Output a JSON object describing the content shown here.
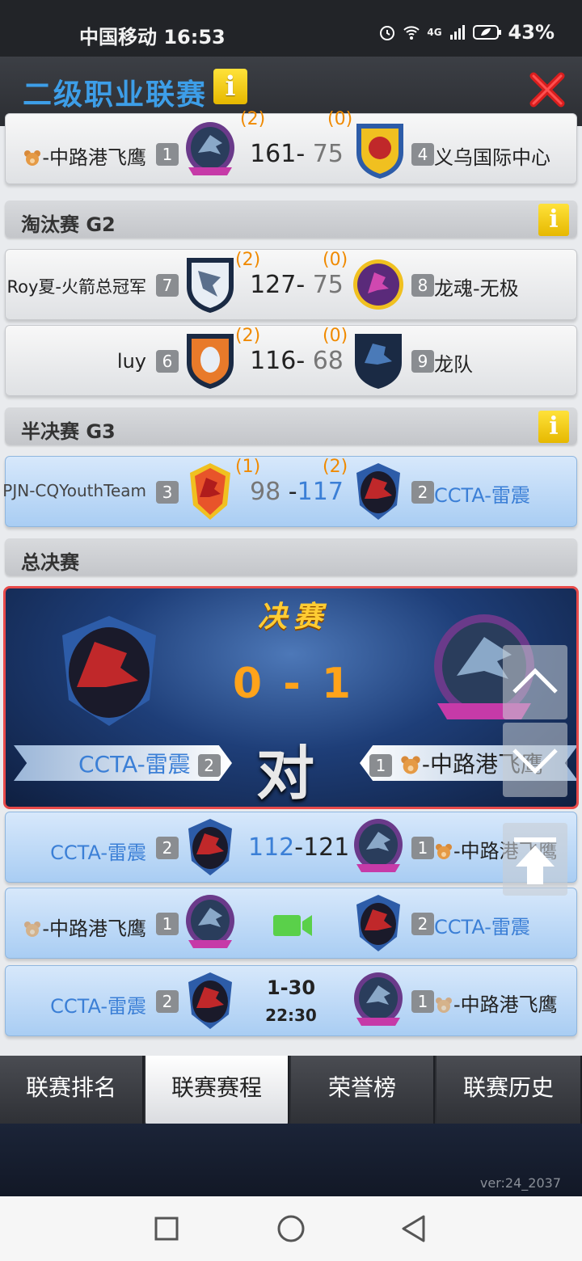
{
  "status_bar": {
    "carrier_time": "中国移动 16:53",
    "battery": "43%",
    "network": "4G"
  },
  "header": {
    "title": "二级职业联赛",
    "info_label": "i"
  },
  "matches_top": {
    "team_left": "-中路港飞鹰",
    "seed_left": "1",
    "wins_left": "(2)",
    "score_left": "161",
    "score_right": "75",
    "wins_right": "(0)",
    "seed_right": "4",
    "team_right": "义乌国际中心"
  },
  "sections": {
    "g2": "淘汰赛 G2",
    "g3": "半决赛 G3",
    "final": "总决赛"
  },
  "g2_matches": [
    {
      "team_left": "Roy夏-火箭总冠军",
      "seed_left": "7",
      "wins_left": "(2)",
      "score_left": "127",
      "score_right": "75",
      "wins_right": "(0)",
      "seed_right": "8",
      "team_right": "龙魂-无极"
    },
    {
      "team_left": "luy",
      "seed_left": "6",
      "wins_left": "(2)",
      "score_left": "116",
      "score_right": "68",
      "wins_right": "(0)",
      "seed_right": "9",
      "team_right": "龙队"
    }
  ],
  "g3_match": {
    "team_left": "PJN-CQYouthTeam",
    "seed_left": "3",
    "wins_left": "(1)",
    "score_left": "98",
    "score_right": "117",
    "wins_right": "(2)",
    "seed_right": "2",
    "team_right": "CCTA-雷震"
  },
  "final": {
    "title": "决赛",
    "series_score": "0 - 1",
    "vs": "对",
    "team_left": "CCTA-雷震",
    "seed_left": "2",
    "team_right": "-中路港飞鹰",
    "seed_right": "1"
  },
  "final_games": [
    {
      "team_left": "CCTA-雷震",
      "seed_left": "2",
      "score_left": "112",
      "score_right": "121",
      "seed_right": "1",
      "team_right": "-中路港飞鹰"
    },
    {
      "team_left": "-中路港飞鹰",
      "seed_left": "1",
      "status": "video",
      "seed_right": "2",
      "team_right": "CCTA-雷震"
    },
    {
      "team_left": "CCTA-雷震",
      "seed_left": "2",
      "date": "1-30",
      "time": "22:30",
      "seed_right": "1",
      "team_right": "-中路港飞鹰"
    }
  ],
  "tabs": [
    "联赛排名",
    "联赛赛程",
    "荣誉榜",
    "联赛历史"
  ],
  "active_tab": "联赛赛程",
  "version": "ver:24_2037",
  "colors": {
    "accent_blue": "#3b7fd6",
    "header_blue": "#3d9ee8",
    "win_orange": "#f08a00",
    "final_score": "#ffa31a",
    "info_yellow": "#ffd21f"
  }
}
